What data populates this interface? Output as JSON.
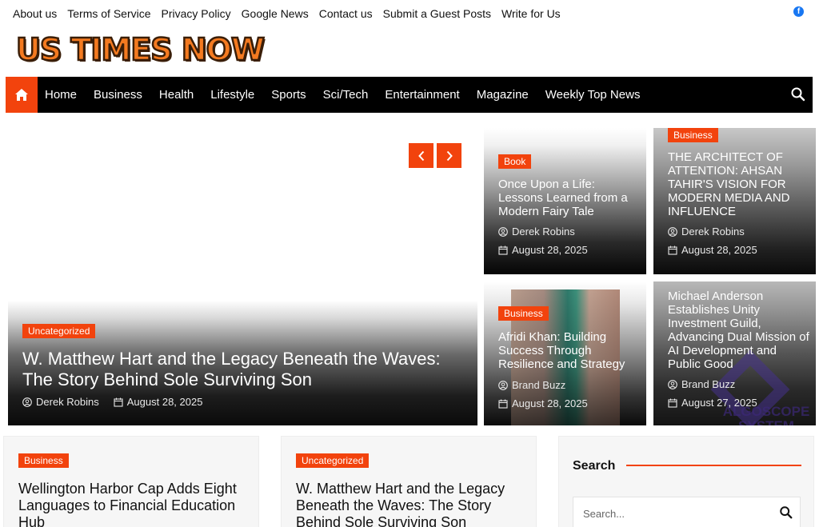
{
  "top_links": [
    "About us",
    "Terms of Service",
    "Privacy Policy",
    "Google News",
    "Contact us",
    "Submit a Guest Posts",
    "Write for Us"
  ],
  "social": {
    "icon": "facebook-icon",
    "glyph": "f",
    "color": "#1877f2"
  },
  "site": {
    "logo_text": "US TIMES NOW",
    "accent": "#f2430d",
    "logo_color": "#f47a20"
  },
  "nav": {
    "home_icon": "home-icon",
    "items": [
      "Home",
      "Business",
      "Health",
      "Lifestyle",
      "Sports",
      "Sci/Tech",
      "Entertainment",
      "Magazine",
      "Weekly Top News"
    ],
    "search_icon": "search-icon"
  },
  "slider": {
    "prev_glyph": "‹",
    "next_glyph": "›"
  },
  "hero": {
    "category": "Uncategorized",
    "title": "W. Matthew Hart and the Legacy Beneath the Waves: The Story Behind Sole Surviving Son",
    "author": "Derek Robins",
    "date": "August 28, 2025"
  },
  "grid": [
    {
      "category": "Book",
      "title": "Once Upon a Life: Lessons Learned from a Modern Fairy Tale",
      "author": "Derek Robins",
      "date": "August 28, 2025"
    },
    {
      "category": "Business",
      "title": "THE ARCHITECT OF ATTENTION: AHSAN TAHIR'S VISION FOR MODERN MEDIA AND INFLUENCE",
      "author": "Derek Robins",
      "date": "August 28, 2025"
    },
    {
      "category": "Business",
      "title": "Afridi Khan: Building Success Through Resilience and Strategy",
      "author": "Brand Buzz",
      "date": "August 28, 2025"
    },
    {
      "category": "",
      "title": "Michael Anderson Establishes Unity Investment Guild, Advancing Dual Mission of AI Development and Public Good",
      "author": "Brand Buzz",
      "date": "August 27, 2025",
      "watermark": "ALGOSCOPE SYSTEM"
    }
  ],
  "posts": [
    {
      "category": "Business",
      "title": "Wellington Harbor Cap Adds Eight Languages to Financial Education Hub"
    },
    {
      "category": "Uncategorized",
      "title": "W. Matthew Hart and the Legacy Beneath the Waves: The Story Behind Sole Surviving Son"
    }
  ],
  "sidebar": {
    "search_title": "Search",
    "search_placeholder": "Search..."
  }
}
